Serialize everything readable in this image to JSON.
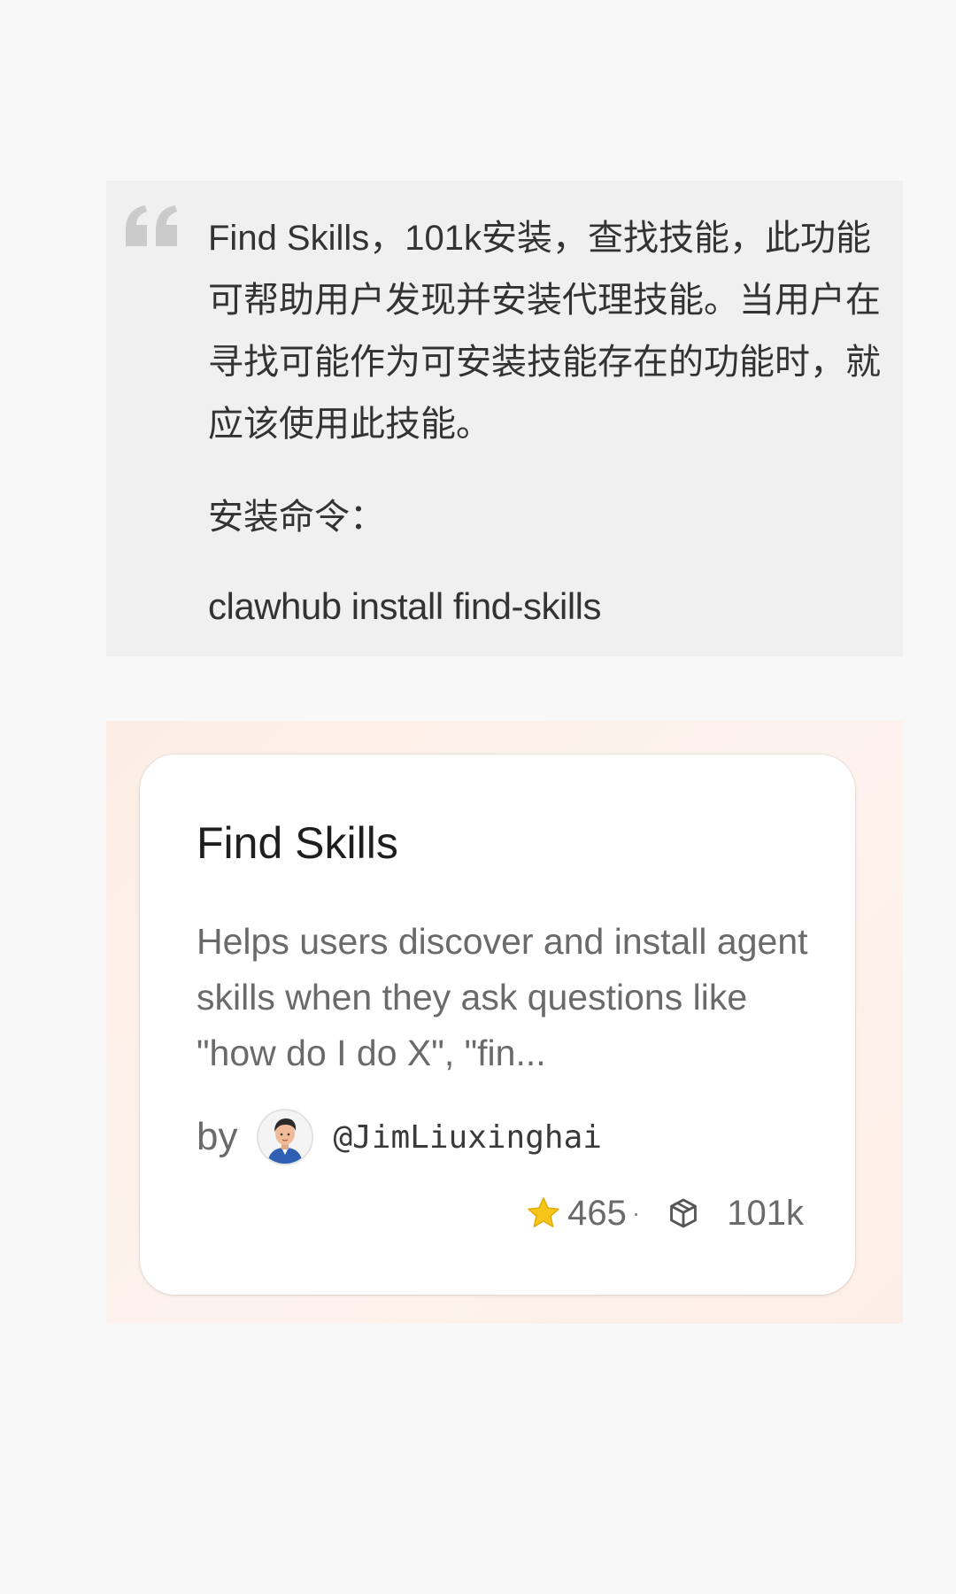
{
  "quote": {
    "text": "Find Skills，101k安装，查找技能，此功能可帮助用户发现并安装代理技能。当用户在寻找可能作为可安装技能存在的功能时，就应该使用此技能。",
    "install_label": "安装命令：",
    "install_command": "clawhub install find-skills",
    "icon": "quote-mark-icon"
  },
  "card": {
    "title": "Find Skills",
    "description": "Helps users discover and install agent skills when they ask questions like \"how do I do X\", \"fin...",
    "by_label": "by",
    "author_handle": "@JimLiuxinghai",
    "stars": "465",
    "separator": "·",
    "installs": "101k",
    "icons": {
      "avatar": "avatar-memoji",
      "star": "star-icon",
      "installs": "package-icon"
    }
  },
  "colors": {
    "page_bg": "#f8f8f8",
    "quote_bg": "#f0f0f0",
    "card_area_bg": "#fcefe7",
    "card_bg": "#ffffff",
    "star": "#f5c518"
  }
}
